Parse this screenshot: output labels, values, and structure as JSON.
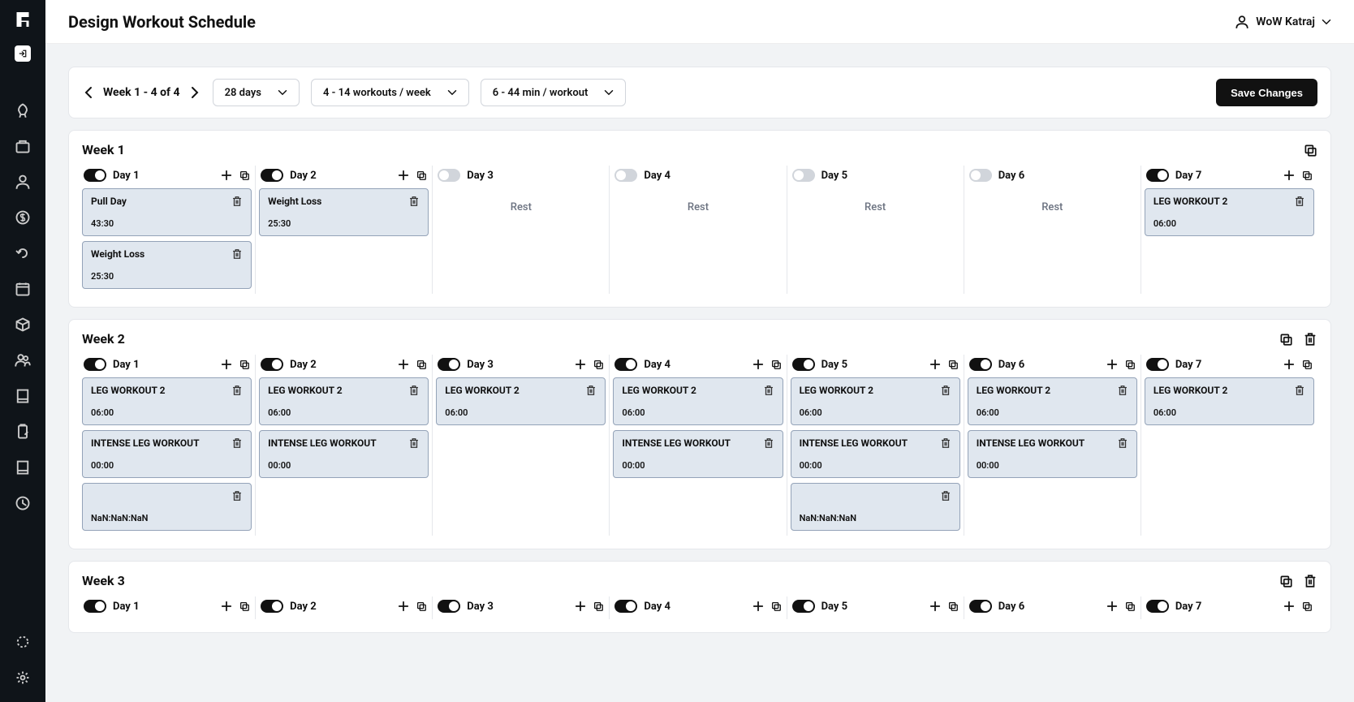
{
  "header": {
    "title": "Design Workout Schedule",
    "user": "WoW Katraj"
  },
  "toolbar": {
    "range": "Week 1 - 4 of 4",
    "duration": "28 days",
    "workouts": "4 - 14 workouts / week",
    "minutes": "6 - 44 min / workout",
    "save": "Save Changes"
  },
  "restLabel": "Rest",
  "weeks": [
    {
      "title": "Week 1",
      "canDelete": false,
      "days": [
        {
          "label": "Day 1",
          "active": true,
          "cards": [
            {
              "name": "Pull Day",
              "time": "43:30"
            },
            {
              "name": "Weight Loss",
              "time": "25:30"
            }
          ]
        },
        {
          "label": "Day 2",
          "active": true,
          "cards": [
            {
              "name": "Weight Loss",
              "time": "25:30"
            }
          ]
        },
        {
          "label": "Day 3",
          "active": false,
          "cards": []
        },
        {
          "label": "Day 4",
          "active": false,
          "cards": []
        },
        {
          "label": "Day 5",
          "active": false,
          "cards": []
        },
        {
          "label": "Day 6",
          "active": false,
          "cards": []
        },
        {
          "label": "Day 7",
          "active": true,
          "cards": [
            {
              "name": "LEG WORKOUT 2",
              "time": "06:00"
            }
          ]
        }
      ]
    },
    {
      "title": "Week 2",
      "canDelete": true,
      "days": [
        {
          "label": "Day 1",
          "active": true,
          "cards": [
            {
              "name": "LEG WORKOUT 2",
              "time": "06:00"
            },
            {
              "name": "INTENSE LEG WORKOUT",
              "time": "00:00"
            },
            {
              "name": "",
              "time": "NaN:NaN:NaN"
            }
          ]
        },
        {
          "label": "Day 2",
          "active": true,
          "cards": [
            {
              "name": "LEG WORKOUT 2",
              "time": "06:00"
            },
            {
              "name": "INTENSE LEG WORKOUT",
              "time": "00:00"
            }
          ]
        },
        {
          "label": "Day 3",
          "active": true,
          "cards": [
            {
              "name": "LEG WORKOUT 2",
              "time": "06:00"
            }
          ]
        },
        {
          "label": "Day 4",
          "active": true,
          "cards": [
            {
              "name": "LEG WORKOUT 2",
              "time": "06:00"
            },
            {
              "name": "INTENSE LEG WORKOUT",
              "time": "00:00"
            }
          ]
        },
        {
          "label": "Day 5",
          "active": true,
          "cards": [
            {
              "name": "LEG WORKOUT 2",
              "time": "06:00"
            },
            {
              "name": "INTENSE LEG WORKOUT",
              "time": "00:00"
            },
            {
              "name": "",
              "time": "NaN:NaN:NaN"
            }
          ]
        },
        {
          "label": "Day 6",
          "active": true,
          "cards": [
            {
              "name": "LEG WORKOUT 2",
              "time": "06:00"
            },
            {
              "name": "INTENSE LEG WORKOUT",
              "time": "00:00"
            }
          ]
        },
        {
          "label": "Day 7",
          "active": true,
          "cards": [
            {
              "name": "LEG WORKOUT 2",
              "time": "06:00"
            }
          ]
        }
      ]
    },
    {
      "title": "Week 3",
      "canDelete": true,
      "days": [
        {
          "label": "Day 1",
          "active": true,
          "cards": []
        },
        {
          "label": "Day 2",
          "active": true,
          "cards": []
        },
        {
          "label": "Day 3",
          "active": true,
          "cards": []
        },
        {
          "label": "Day 4",
          "active": true,
          "cards": []
        },
        {
          "label": "Day 5",
          "active": true,
          "cards": []
        },
        {
          "label": "Day 6",
          "active": true,
          "cards": []
        },
        {
          "label": "Day 7",
          "active": true,
          "cards": []
        }
      ]
    }
  ]
}
